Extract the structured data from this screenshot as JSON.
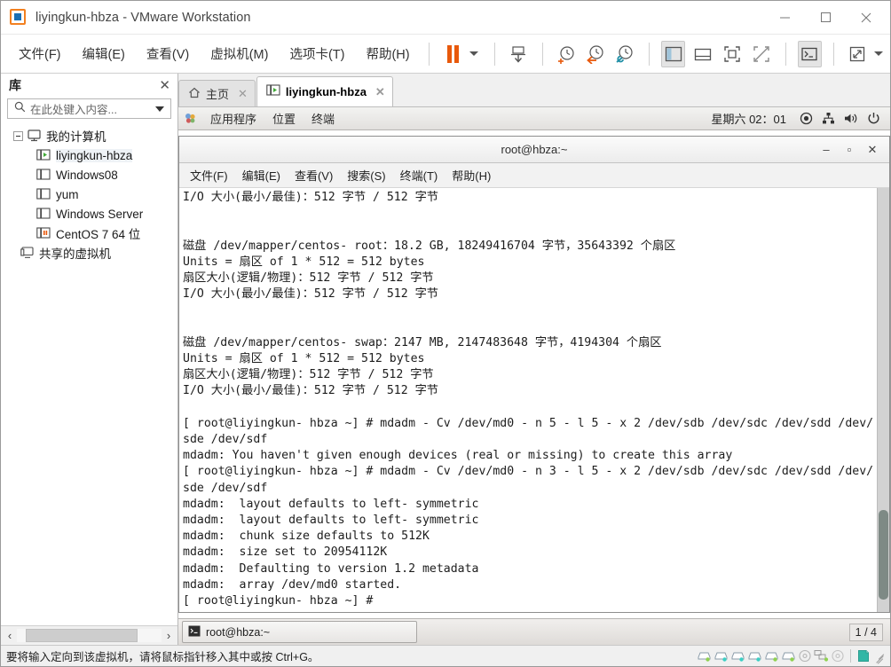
{
  "window": {
    "title": "liyingkun-hbza - VMware Workstation",
    "app_icon": "vmware-logo-icon",
    "minimize_label": "—",
    "maximize_label": "□",
    "close_label": "✕"
  },
  "menubar": {
    "items": [
      {
        "label": "文件(F)",
        "name": "menu-file"
      },
      {
        "label": "编辑(E)",
        "name": "menu-edit"
      },
      {
        "label": "查看(V)",
        "name": "menu-view"
      },
      {
        "label": "虚拟机(M)",
        "name": "menu-vm"
      },
      {
        "label": "选项卡(T)",
        "name": "menu-tabs"
      },
      {
        "label": "帮助(H)",
        "name": "menu-help"
      }
    ],
    "toolbar": [
      {
        "name": "suspend-button",
        "icon": "pause-icon"
      },
      {
        "name": "suspend-dropdown",
        "icon": "chevron-down-icon"
      },
      {
        "name": "power-button",
        "icon": "power-vm-icon"
      },
      {
        "name": "snapshot-take-button",
        "icon": "snapshot-add-icon"
      },
      {
        "name": "snapshot-revert-button",
        "icon": "snapshot-revert-icon"
      },
      {
        "name": "snapshot-manager-button",
        "icon": "snapshot-manage-icon"
      },
      {
        "name": "show-library-button",
        "icon": "library-panel-icon"
      },
      {
        "name": "show-thumbnail-bar-button",
        "icon": "thumbnail-bar-icon"
      },
      {
        "name": "full-screen-button",
        "icon": "fullscreen-icon"
      },
      {
        "name": "unity-mode-button",
        "icon": "unity-icon"
      },
      {
        "name": "console-view-button",
        "icon": "console-icon"
      },
      {
        "name": "stretch-button",
        "icon": "stretch-icon"
      },
      {
        "name": "stretch-dropdown",
        "icon": "chevron-down-icon"
      }
    ]
  },
  "sidebar": {
    "title": "库",
    "close_label": "✕",
    "search": {
      "placeholder": "在此处键入内容...",
      "value": ""
    },
    "tree": [
      {
        "label": "我的计算机",
        "name": "tree-my-computer",
        "level": 0,
        "icon": "computer-icon",
        "expander": true,
        "selected": false
      },
      {
        "label": "liyingkun-hbza",
        "name": "tree-vm-liyingkun-hbza",
        "level": 1,
        "icon": "vm-running-icon",
        "expander": false,
        "selected": true
      },
      {
        "label": "Windows08",
        "name": "tree-vm-windows08",
        "level": 1,
        "icon": "vm-icon",
        "expander": false,
        "selected": false
      },
      {
        "label": "yum",
        "name": "tree-vm-yum",
        "level": 1,
        "icon": "vm-icon",
        "expander": false,
        "selected": false
      },
      {
        "label": "Windows Server",
        "name": "tree-vm-windows-server",
        "level": 1,
        "icon": "vm-icon",
        "expander": false,
        "selected": false
      },
      {
        "label": "CentOS 7 64 位",
        "name": "tree-vm-centos7",
        "level": 1,
        "icon": "vm-suspended-icon",
        "expander": false,
        "selected": false
      },
      {
        "label": "共享的虚拟机",
        "name": "tree-shared-vms",
        "level": 0,
        "icon": "shared-vm-icon",
        "expander": false,
        "selected": false
      }
    ],
    "scroll_left_label": "‹",
    "scroll_right_label": "›"
  },
  "tabs": [
    {
      "label": "主页",
      "name": "tab-home",
      "icon": "home-icon",
      "active": false,
      "close_label": "✕"
    },
    {
      "label": "liyingkun-hbza",
      "name": "tab-vm-liyingkun-hbza",
      "icon": "vm-running-icon",
      "active": true,
      "close_label": "✕"
    }
  ],
  "guest_panel": {
    "menus": [
      {
        "label": "应用程序",
        "name": "gnome-applications-menu"
      },
      {
        "label": "位置",
        "name": "gnome-places-menu"
      },
      {
        "label": "终端",
        "name": "gnome-terminal-menu"
      }
    ],
    "clock": "星期六 02：01",
    "tray": [
      {
        "name": "accessibility-icon"
      },
      {
        "name": "network-icon"
      },
      {
        "name": "volume-icon"
      },
      {
        "name": "power-menu-icon"
      }
    ]
  },
  "terminal": {
    "title": "root@hbza:~",
    "minimize_label": "–",
    "maximize_label": "▫",
    "close_label": "✕",
    "menus": [
      {
        "label": "文件(F)",
        "name": "term-menu-file"
      },
      {
        "label": "编辑(E)",
        "name": "term-menu-edit"
      },
      {
        "label": "查看(V)",
        "name": "term-menu-view"
      },
      {
        "label": "搜索(S)",
        "name": "term-menu-search"
      },
      {
        "label": "终端(T)",
        "name": "term-menu-terminal"
      },
      {
        "label": "帮助(H)",
        "name": "term-menu-help"
      }
    ],
    "content": "I/O 大小(最小/最佳)：512 字节 / 512 字节\n\n\n磁盘 /dev/mapper/centos- root：18.2 GB, 18249416704 字节，35643392 个扇区\nUnits = 扇区 of 1 * 512 = 512 bytes\n扇区大小(逻辑/物理)：512 字节 / 512 字节\nI/O 大小(最小/最佳)：512 字节 / 512 字节\n\n\n磁盘 /dev/mapper/centos- swap：2147 MB, 2147483648 字节，4194304 个扇区\nUnits = 扇区 of 1 * 512 = 512 bytes\n扇区大小(逻辑/物理)：512 字节 / 512 字节\nI/O 大小(最小/最佳)：512 字节 / 512 字节\n\n[ root@liyingkun- hbza ~] # mdadm - Cv /dev/md0 - n 5 - l 5 - x 2 /dev/sdb /dev/sdc /dev/sdd /dev/sde /dev/sdf\nmdadm: You haven't given enough devices (real or missing) to create this array\n[ root@liyingkun- hbza ~] # mdadm - Cv /dev/md0 - n 3 - l 5 - x 2 /dev/sdb /dev/sdc /dev/sdd /dev/sde /dev/sdf\nmdadm:  layout defaults to left- symmetric\nmdadm:  layout defaults to left- symmetric\nmdadm:  chunk size defaults to 512K\nmdadm:  size set to 20954112K\nmdadm:  Defaulting to version 1.2 metadata\nmdadm:  array /dev/md0 started.\n[ root@liyingkun- hbza ~] #"
  },
  "guest_taskbar": {
    "window_label": "root@hbza:~",
    "window_icon": "terminal-icon",
    "workspace_switcher": "1 / 4"
  },
  "statusbar": {
    "message": "要将输入定向到该虚拟机，请将鼠标指针移入其中或按 Ctrl+G。",
    "devices": [
      {
        "name": "status-harddisk-1-icon"
      },
      {
        "name": "status-harddisk-2-icon"
      },
      {
        "name": "status-harddisk-3-icon"
      },
      {
        "name": "status-harddisk-4-icon"
      },
      {
        "name": "status-harddisk-5-icon"
      },
      {
        "name": "status-harddisk-6-icon"
      },
      {
        "name": "status-cddvd-icon"
      },
      {
        "name": "status-network-icon"
      },
      {
        "name": "status-usb-icon"
      },
      {
        "name": "status-printer-icon"
      }
    ]
  },
  "colors": {
    "accent_orange": "#e8590c",
    "accent_blue": "#1a6fb4",
    "vm_green": "#3faa35",
    "chrome_bg": "#f0f0f0"
  }
}
